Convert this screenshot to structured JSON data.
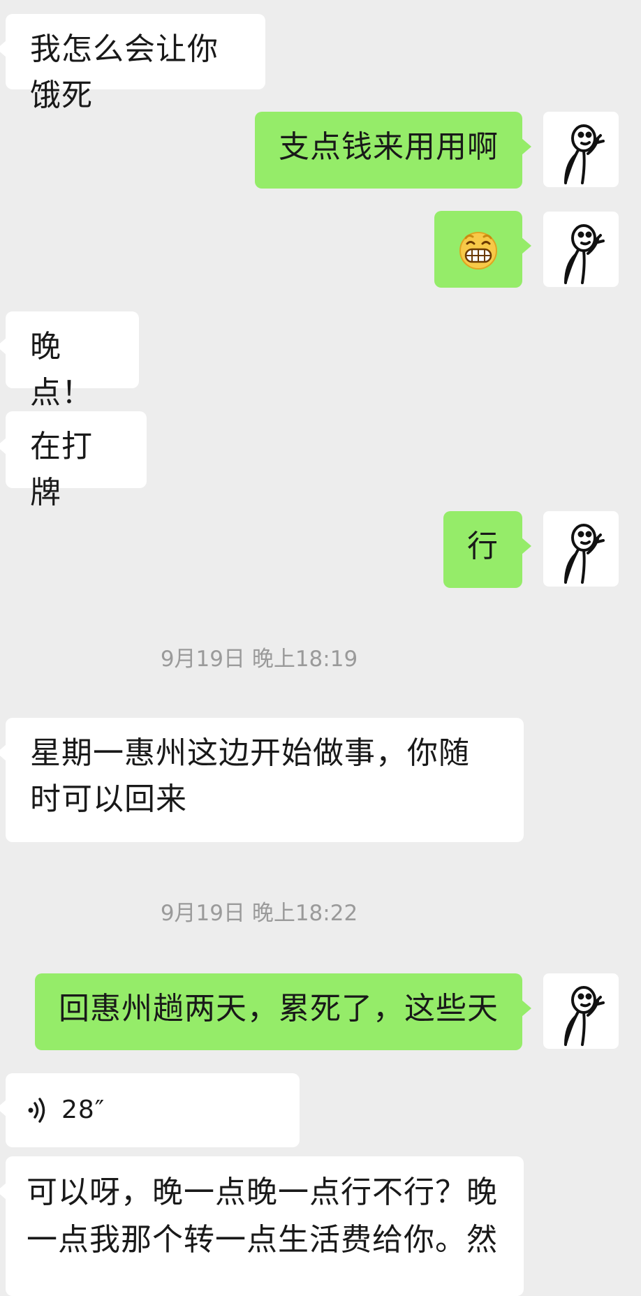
{
  "messages": [
    {
      "id": "m1",
      "side": "in",
      "type": "text",
      "text": "我怎么会让你饿死"
    },
    {
      "id": "m2",
      "side": "out",
      "type": "text",
      "text": "支点钱来用用啊"
    },
    {
      "id": "m3",
      "side": "out",
      "type": "emoji",
      "emoji": "grinning-face-emoji"
    },
    {
      "id": "m4",
      "side": "in",
      "type": "text",
      "text": "晚点！"
    },
    {
      "id": "m5",
      "side": "in",
      "type": "text",
      "text": "在打牌"
    },
    {
      "id": "m6",
      "side": "out",
      "type": "text",
      "text": "行"
    },
    {
      "id": "t1",
      "type": "timestamp",
      "text": "9月19日 晚上18:19"
    },
    {
      "id": "m7",
      "side": "in",
      "type": "text",
      "text": "星期一惠州这边开始做事，你随时可以回来"
    },
    {
      "id": "t2",
      "type": "timestamp",
      "text": "9月19日 晚上18:22"
    },
    {
      "id": "m8",
      "side": "out",
      "type": "text",
      "text": "回惠州趟两天，累死了，这些天"
    },
    {
      "id": "m9",
      "side": "in",
      "type": "voice",
      "duration": "28″",
      "icon": "voice-wave-icon"
    },
    {
      "id": "m10",
      "side": "in",
      "type": "text",
      "text": "可以呀，晚一点晚一点行不行？晚一点我那个转一点生活费给你。然"
    }
  ],
  "colors": {
    "background": "#ededed",
    "incoming_bubble": "#ffffff",
    "outgoing_bubble": "#95ec69",
    "timestamp_text": "#9a9a9a"
  },
  "self_avatar": "stick-figure-avatar"
}
